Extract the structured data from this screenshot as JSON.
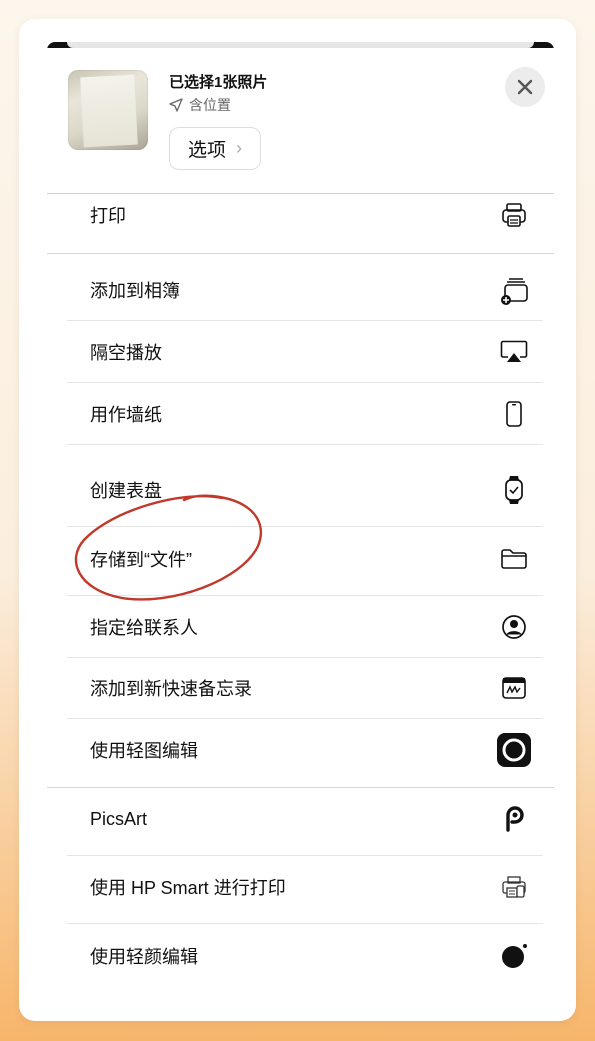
{
  "header": {
    "title": "已选择1张照片",
    "location_label": "含位置",
    "options_label": "选项",
    "options_chevron": "›"
  },
  "actions": [
    {
      "label": "打印",
      "icon": "printer-icon"
    },
    {
      "label": "添加到相簿",
      "icon": "add-to-album-icon"
    },
    {
      "label": "隔空播放",
      "icon": "airplay-icon"
    },
    {
      "label": "用作墙纸",
      "icon": "phone-icon"
    },
    {
      "label": "创建表盘",
      "icon": "watch-icon"
    },
    {
      "label": "存储到“文件”",
      "icon": "folder-icon"
    },
    {
      "label": "指定给联系人",
      "icon": "contact-icon"
    },
    {
      "label": "添加到新快速备忘录",
      "icon": "quick-note-icon"
    },
    {
      "label": "使用轻图编辑",
      "icon": "app-circle-icon"
    },
    {
      "label": "PicsArt",
      "icon": "picsart-icon"
    },
    {
      "label": "使用 HP Smart 进行打印",
      "icon": "hp-smart-icon"
    },
    {
      "label": "使用轻颜编辑",
      "icon": "app-dot-icon"
    }
  ],
  "colors": {
    "annotation": "#c0392b",
    "separator": "#e5e5e5"
  }
}
